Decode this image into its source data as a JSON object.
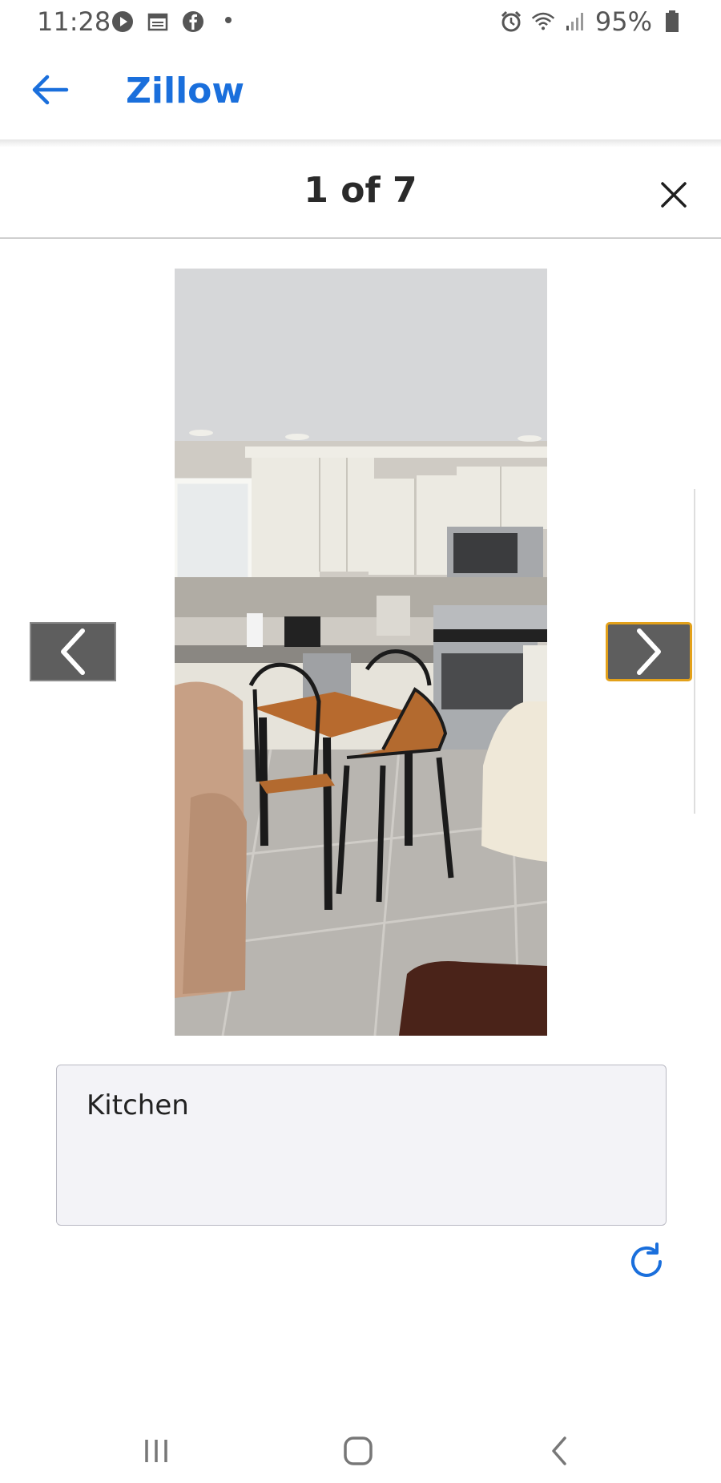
{
  "status_bar": {
    "time": "11:28",
    "left_icons": [
      "play-icon",
      "calendar-icon",
      "facebook-icon",
      "dot-icon"
    ],
    "right_icons": [
      "alarm-icon",
      "wifi-icon",
      "signal-icon",
      "battery-icon"
    ],
    "battery": "95%"
  },
  "app_bar": {
    "title": "Zillow",
    "back_icon": "arrow-left-icon",
    "accent_color": "#1a6fdc"
  },
  "gallery": {
    "counter": "1 of 7",
    "close_icon": "close-icon",
    "current_index": 1,
    "total": 7,
    "prev_icon": "chevron-left-icon",
    "next_icon": "chevron-right-icon",
    "focus_color": "#e3a11a"
  },
  "caption": {
    "text": "Kitchen",
    "refresh_icon": "refresh-icon"
  },
  "system_nav": {
    "recents_icon": "recents-icon",
    "home_icon": "home-icon",
    "back_icon": "system-back-icon"
  }
}
